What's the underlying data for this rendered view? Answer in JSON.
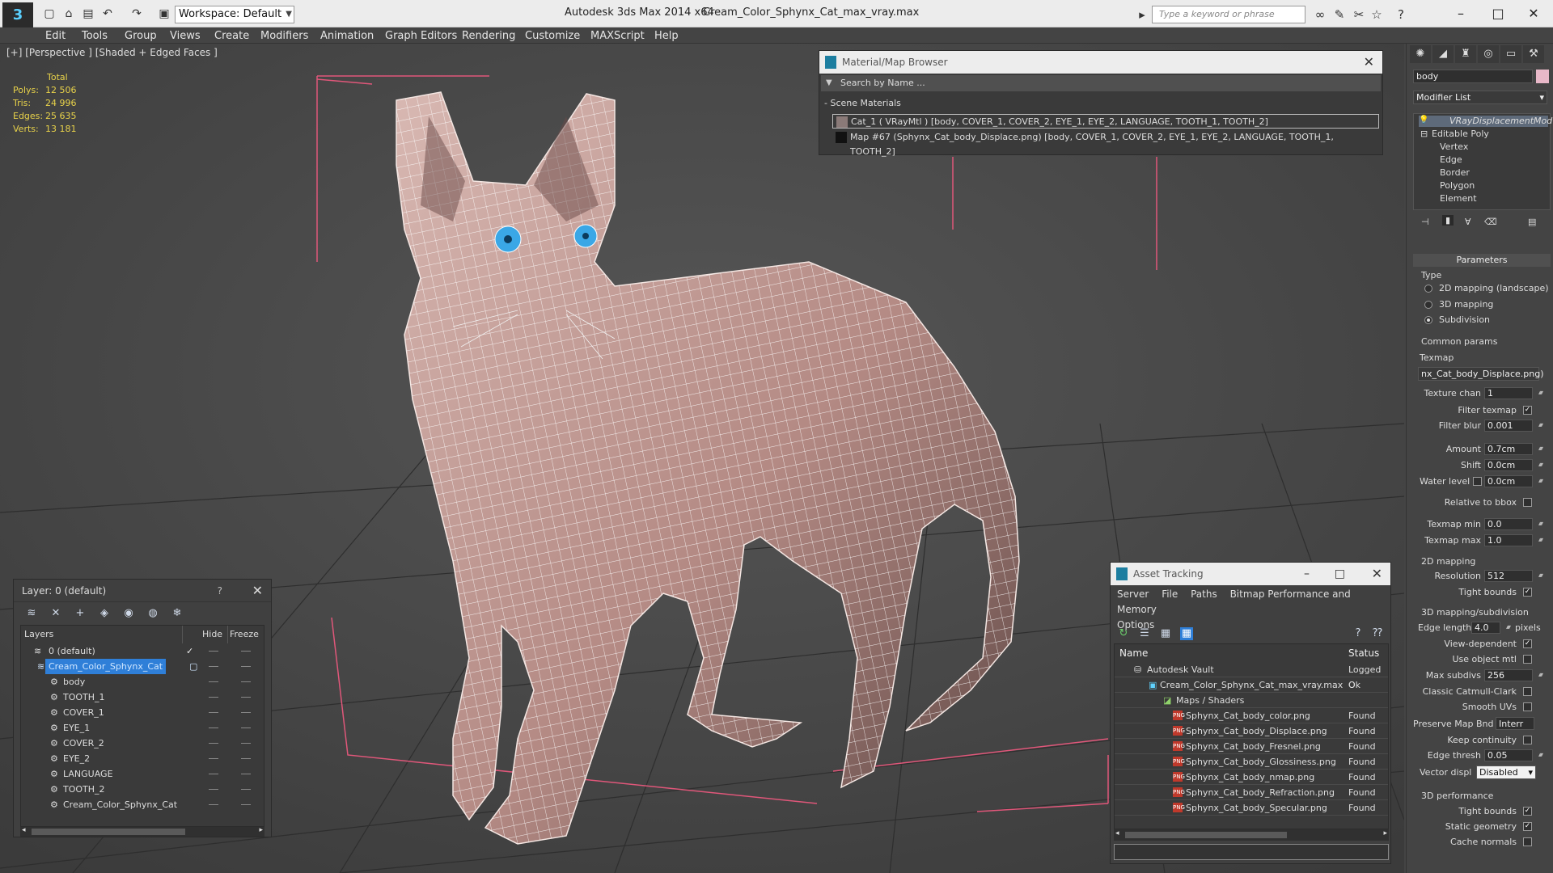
{
  "titlebar": {
    "workspace_label": "Workspace: Default",
    "app_title": "Autodesk 3ds Max  2014 x64",
    "file_title": "Cream_Color_Sphynx_Cat_max_vray.max",
    "search_placeholder": "Type a keyword or phrase",
    "logo": "3"
  },
  "menu": [
    "Edit",
    "Tools",
    "Group",
    "Views",
    "Create",
    "Modifiers",
    "Animation",
    "Graph Editors",
    "Rendering",
    "Customize",
    "MAXScript",
    "Help"
  ],
  "viewport": {
    "label": "[+] [Perspective ] [Shaded + Edged Faces ]",
    "stats": {
      "header": "Total",
      "rows": [
        {
          "k": "Polys:",
          "v": "12 506"
        },
        {
          "k": "Tris:",
          "v": "24 996"
        },
        {
          "k": "Edges:",
          "v": "25 635"
        },
        {
          "k": "Verts:",
          "v": "13 181"
        }
      ]
    }
  },
  "material_browser": {
    "title": "Material/Map Browser",
    "search": "Search by Name ...",
    "section": "- Scene Materials",
    "rows": [
      "Cat_1  ( VRayMtl )  [body, COVER_1, COVER_2, EYE_1, EYE_2, LANGUAGE, TOOTH_1, TOOTH_2]",
      "Map #67 (Sphynx_Cat_body_Displace.png)  [body, COVER_1, COVER_2, EYE_1, EYE_2, LANGUAGE, TOOTH_1, TOOTH_2]"
    ]
  },
  "command_panel": {
    "object_name": "body",
    "modifier_list": "Modifier List",
    "stack": [
      "VRayDisplacementMod",
      "Editable Poly",
      "Vertex",
      "Edge",
      "Border",
      "Polygon",
      "Element"
    ],
    "rollout": "Parameters",
    "type_label": "Type",
    "type_options": [
      "2D mapping (landscape)",
      "3D mapping",
      "Subdivision"
    ],
    "common_params": "Common params",
    "texmap_label": "Texmap",
    "texmap_value": "nx_Cat_body_Displace.png)",
    "texture_chan_label": "Texture chan",
    "texture_chan": "1",
    "filter_texmap": "Filter texmap",
    "filter_blur_label": "Filter blur",
    "filter_blur": "0.001",
    "amount_label": "Amount",
    "amount": "0.7cm",
    "shift_label": "Shift",
    "shift": "0.0cm",
    "water_level_label": "Water level",
    "water_level": "0.0cm",
    "relative_bbox": "Relative to bbox",
    "texmap_min_label": "Texmap min",
    "texmap_min": "0.0",
    "texmap_max_label": "Texmap max",
    "texmap_max": "1.0",
    "mapping_2d": "2D mapping",
    "resolution_label": "Resolution",
    "resolution": "512",
    "tight_bounds": "Tight bounds",
    "mapping_3d": "3D mapping/subdivision",
    "edge_length_label": "Edge length",
    "edge_length": "4.0",
    "pixels": "pixels",
    "view_dependent": "View-dependent",
    "use_object_mtl": "Use object mtl",
    "max_subdivs_label": "Max subdivs",
    "max_subdivs": "256",
    "classic_catmull": "Classic Catmull-Clark",
    "smooth_uvs": "Smooth UVs",
    "preserve_map_label": "Preserve Map Bnd",
    "preserve_map": "Interr",
    "keep_continuity": "Keep continuity",
    "edge_thresh_label": "Edge thresh",
    "edge_thresh": "0.05",
    "vector_displ_label": "Vector displ",
    "vector_displ": "Disabled",
    "performance": "3D performance",
    "tight_bounds_2": "Tight bounds",
    "static_geometry": "Static geometry",
    "cache_normals": "Cache normals"
  },
  "layer_panel": {
    "title": "Layer: 0 (default)",
    "help": "?",
    "col_layers": "Layers",
    "col_hide": "Hide",
    "col_freeze": "Freeze",
    "rows": [
      "0 (default)",
      "Cream_Color_Sphynx_Cat",
      "body",
      "TOOTH_1",
      "COVER_1",
      "EYE_1",
      "COVER_2",
      "EYE_2",
      "LANGUAGE",
      "TOOTH_2",
      "Cream_Color_Sphynx_Cat"
    ]
  },
  "asset_panel": {
    "title": "Asset Tracking",
    "menu": [
      "Server",
      "File",
      "Paths",
      "Bitmap Performance and Memory",
      "Options"
    ],
    "col_name": "Name",
    "col_status": "Status",
    "rows": [
      {
        "name": "Autodesk Vault",
        "status": "Logged O"
      },
      {
        "name": "Cream_Color_Sphynx_Cat_max_vray.max",
        "status": "Ok"
      },
      {
        "name": "Maps / Shaders",
        "status": ""
      },
      {
        "name": "Sphynx_Cat_body_color.png",
        "status": "Found"
      },
      {
        "name": "Sphynx_Cat_body_Displace.png",
        "status": "Found"
      },
      {
        "name": "Sphynx_Cat_body_Fresnel.png",
        "status": "Found"
      },
      {
        "name": "Sphynx_Cat_body_Glossiness.png",
        "status": "Found"
      },
      {
        "name": "Sphynx_Cat_body_nmap.png",
        "status": "Found"
      },
      {
        "name": "Sphynx_Cat_body_Refraction.png",
        "status": "Found"
      },
      {
        "name": "Sphynx_Cat_body_Specular.png",
        "status": "Found"
      }
    ]
  },
  "colors": {
    "accent": "#2f7fd8",
    "stats": "#e8d24a",
    "bbox": "#e0577a",
    "grid": "#2e2e2e",
    "cat_fill": "#c9a6a0",
    "eye": "#3aa7e6"
  }
}
